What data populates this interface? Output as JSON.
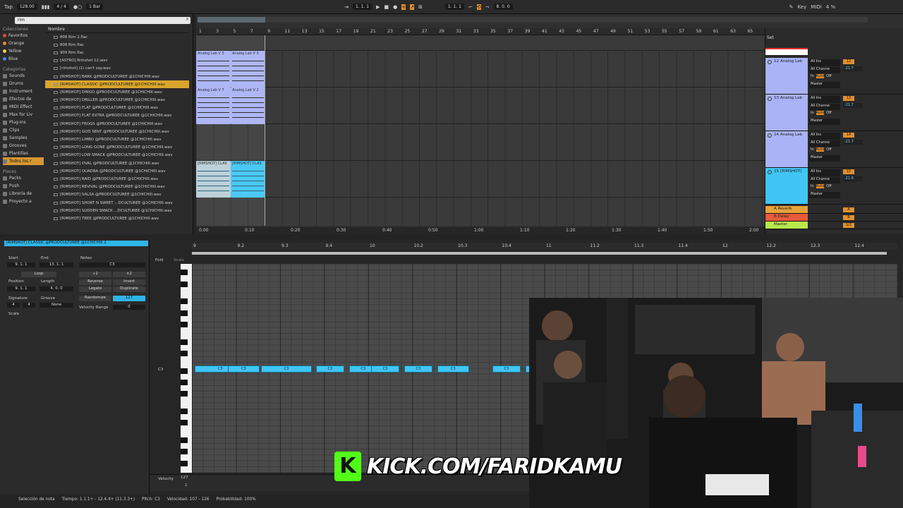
{
  "topbar": {
    "tap": "Tap",
    "tempo": "128.00",
    "signature": "4 / 4",
    "quantize": "1 Bar",
    "position": "1.  1.  1",
    "loop_start": "1.  1.  1",
    "loop_length": "8.  0.  0",
    "key": "Key",
    "midi": "MIDI",
    "cpu": "4 %"
  },
  "browser": {
    "search": "rim",
    "collections_heading": "Colecciones",
    "collections": [
      {
        "label": "Favoritos",
        "color": "#e3493a"
      },
      {
        "label": "Orange",
        "color": "#f08a24"
      },
      {
        "label": "Yellow",
        "color": "#e8d43a"
      },
      {
        "label": "Blue",
        "color": "#3a8ee8"
      }
    ],
    "categories_heading": "Categorías",
    "categories": [
      "Sounds",
      "Drums",
      "Instrument",
      "Efectos de",
      "MIDI Effect",
      "Max for Liv",
      "Plug-Ins",
      "Clips",
      "Samples",
      "Grooves",
      "Plantillas",
      "Todos los r"
    ],
    "places_heading": "Places",
    "places": [
      "Packs",
      "Push",
      "Librería de",
      "Proyecto a"
    ],
    "list_header": "Nombre",
    "files": [
      "808 Rim 2.flac",
      "808 Rim.flac",
      "909 Rim.flac",
      "[ASTRO] Rimshot 12.wav",
      "[rimshot] (1) can't say.wav",
      "[RIMSHOT] BARK @PRODCULTUREE @1CHICHIII.wav",
      "[RIMSHOT] CLASSIC @PRODCULTUREE @1CHICHIII.wav",
      "[RIMSHOT] DINGO @PRODCULTUREE @1CHICHIII.wav",
      "[RIMSHOT] DRILLER @PRODCULTUREE @1CHICHIII.wav",
      "[RIMSHOT] FLAT @PRODCULTUREE @1CHICHIII.wav",
      "[RIMSHOT] FLAT EXTRA @PRODCULTUREE @1CHICHIII.wav",
      "[RIMSHOT] FROGS @PRODCULTUREE @1CHICHIII.wav",
      "[RIMSHOT] GOD SENT @PRODCULTUREE @1CHICHIII.wav",
      "[RIMSHOT] LIMBO @PRODCULTUREE @1CHICHIII.wav",
      "[RIMSHOT] LONG GONE @PRODCULTUREE @1CHICHIII.wav",
      "[RIMSHOT] LOW SMACK @PRODCULTUREE @1CHICHIII.wav",
      "[RIMSHOT] OVAL @PRODCULTUREE @1CHICHIII.wav",
      "[RIMSHOT] QUADRA @PRODCULTUREE @1CHICHIII.wav",
      "[RIMSHOT] RAID @PRODCULTUREE @1CHICHIII.wav",
      "[RIMSHOT] REVIVAL @PRODCULTUREE @1CHICHIII.wav",
      "[RIMSHOT] SALSA @PRODCULTUREE @1CHICHIII.wav",
      "[RIMSHOT] SHORT N SWEET ...DCULTUREE @1CHICHIII.wav",
      "[RIMSHOT] SUDDEN SMACK ...DCULTUREE @1CHICHIII.wav",
      "[RIMSHOT] TREE @PRODCULTUREE @1CHICHIII.wav"
    ],
    "selected_index": 6
  },
  "arrangement": {
    "bars": [
      "1",
      "3",
      "5",
      "7",
      "9",
      "11",
      "13",
      "15",
      "17",
      "19",
      "21",
      "23",
      "25",
      "27",
      "29",
      "31",
      "33",
      "35",
      "37",
      "39",
      "41",
      "43",
      "45",
      "47",
      "49",
      "51",
      "53",
      "55",
      "57",
      "59",
      "61",
      "63",
      "65"
    ],
    "times": [
      "0:00",
      "0:10",
      "0:20",
      "0:30",
      "0:40",
      "0:50",
      "1:00",
      "1:10",
      "1:20",
      "1:30",
      "1:40",
      "1:50",
      "2:00"
    ],
    "clips": [
      {
        "label": "Analog Lab V 3",
        "color": "#a9b3f5"
      },
      {
        "label": "Analog Lab V 3",
        "color": "#a9b3f5"
      },
      {
        "label": "Analog Lab V 7",
        "color": "#a9b3f5"
      },
      {
        "label": "Analog Lab V 2",
        "color": "#a9b3f5"
      },
      {
        "label": "[RIMSHOT] CLAS",
        "color": "#3fc6f5"
      },
      {
        "label": "[RIMSHOT] CLAS",
        "color": "#3fc6f5"
      }
    ],
    "set_label": "Set",
    "tracks": [
      {
        "name": "12 Analog Lab",
        "num": "12",
        "vol": "-21.7",
        "color": "#a9b3f5"
      },
      {
        "name": "13 Analog Lab",
        "num": "13",
        "vol": "-21.7",
        "color": "#a9b3f5"
      },
      {
        "name": "14 Analog Lab",
        "num": "14",
        "vol": "-21.7",
        "color": "#a9b3f5"
      },
      {
        "name": "15 [RIMSHOT]",
        "num": "15",
        "vol": "-21.6",
        "color": "#3fc6f5"
      }
    ],
    "io": {
      "in": "All Ins",
      "channels": "All Channe",
      "monitor": "In",
      "auto": "Auto",
      "off": "Off",
      "out": "Master"
    },
    "returns": [
      {
        "name": "A Reverb",
        "color": "#e8a23a",
        "num": "A"
      },
      {
        "name": "B Delay",
        "color": "#e85a3a",
        "num": "B"
      },
      {
        "name": "Master",
        "color": "#b8e84a",
        "num": "1/2"
      }
    ]
  },
  "clip_detail": {
    "name": "[RIMSHOT] CLASSIC @PRODCULTUREE @1CHICHIII 2",
    "start_label": "Start",
    "end_label": "End",
    "start": "9. 1. 1",
    "end": "13. 1. 1",
    "loop": "Loop",
    "position_label": "Position",
    "length_label": "Length",
    "position": "9. 1. 1",
    "length": "4. 0. 0",
    "signature_label": "Signature",
    "groove_label": "Groove",
    "sig_num": "4",
    "sig_den": "4",
    "groove": "None",
    "scale": "Scale",
    "notes_label": "Notes",
    "note": "C3",
    "x2a": "÷2",
    "x2b": "×2",
    "reverse": "Reverse",
    "invert": "Invert",
    "legato": "Legato",
    "duplicate": "Duplicate",
    "randomize": "Randomize",
    "random_val": "127",
    "vel_range": "Velocity Range",
    "vel_range_val": "0",
    "fold": "Fold",
    "scale_btn": "Scale"
  },
  "piano_roll": {
    "ruler": [
      "9",
      "9.2",
      "9.3",
      "9.4",
      "10",
      "10.2",
      "10.3",
      "10.4",
      "11",
      "11.2",
      "11.3",
      "11.4",
      "12",
      "12.2",
      "12.3",
      "12.4"
    ],
    "row_label": "C3",
    "notes": [
      {
        "label": "C3",
        "start": 0.0,
        "len": 0.29
      },
      {
        "label": "C3",
        "start": 0.75,
        "len": 0.18
      },
      {
        "label": "C3",
        "start": 1.5,
        "len": 0.29
      },
      {
        "label": "C3",
        "start": 2.75,
        "len": 0.16
      },
      {
        "label": "C3",
        "start": 3.5,
        "len": 0.16
      },
      {
        "label": "C3",
        "start": 4.0,
        "len": 0.16
      },
      {
        "label": "C3",
        "start": 4.75,
        "len": 0.16
      },
      {
        "label": "C3",
        "start": 5.5,
        "len": 0.18
      },
      {
        "label": "C3",
        "start": 6.75,
        "len": 0.16
      },
      {
        "label": "C3",
        "start": 7.5,
        "len": 0.16
      }
    ],
    "velocity_label": "Velocity",
    "velocity_max": "127",
    "velocity_min": "1"
  },
  "overlay": {
    "kick_logo": "K",
    "kick_text": "KICK.COM/FARIDKAMU"
  },
  "status": {
    "mode": "Selección de nota",
    "time": "Tiempo: 1.1.1+ - 12.4.4+ (11.3.3+)",
    "pitch": "Pitch: C3",
    "velocity": "Velocidad: 107 - 126",
    "probability": "Probabilidad: 100%"
  }
}
